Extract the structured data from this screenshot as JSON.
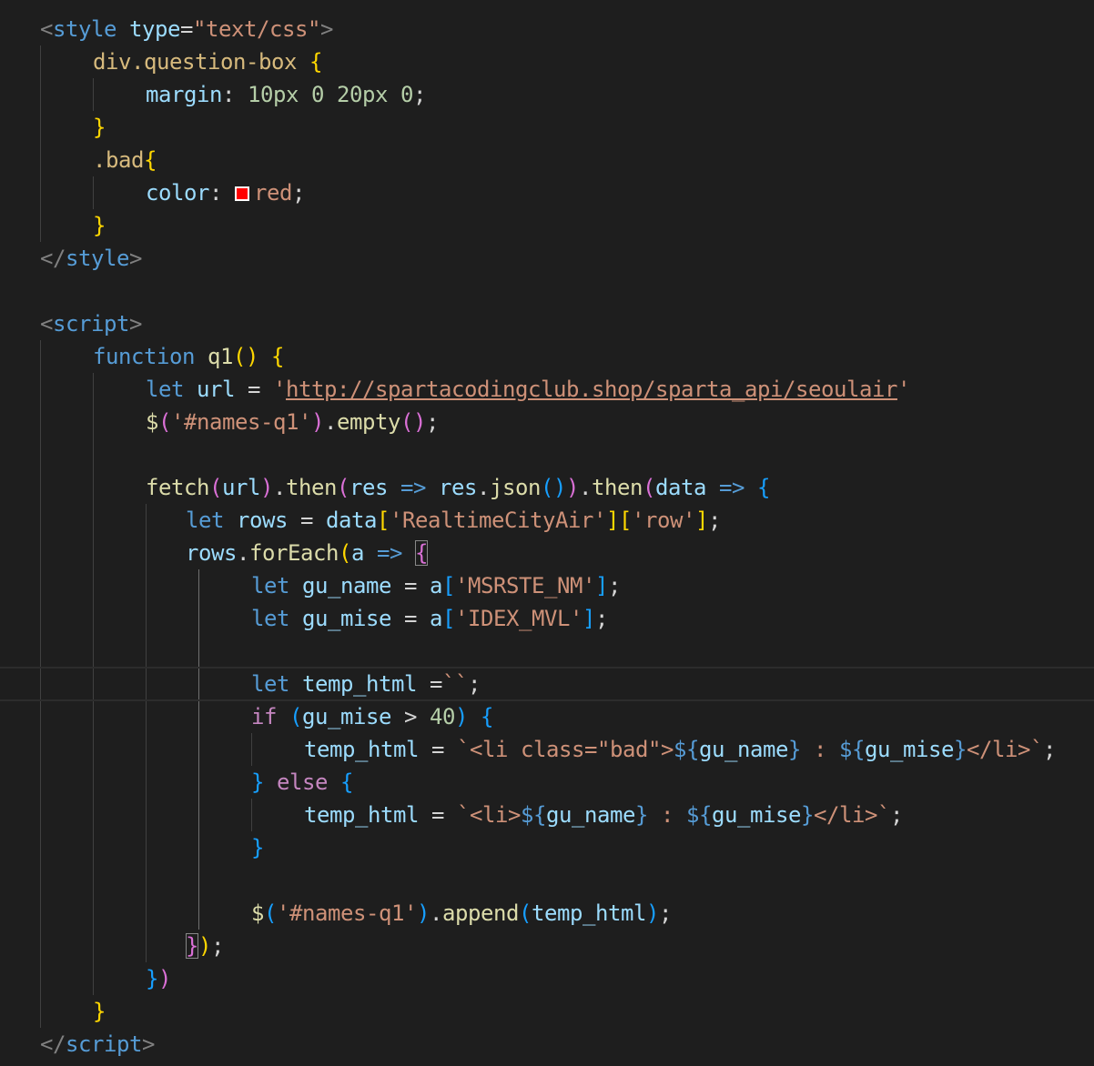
{
  "editor": {
    "theme": "dark",
    "background": "#1e1e1e",
    "current_line_index": 20,
    "lines": [
      {
        "tokens": [
          {
            "t": "<",
            "c": "tag"
          },
          {
            "t": "style",
            "c": "tname"
          },
          {
            "t": " ",
            "c": "pun"
          },
          {
            "t": "type",
            "c": "attr"
          },
          {
            "t": "=",
            "c": "pun"
          },
          {
            "t": "\"text/css\"",
            "c": "str"
          },
          {
            "t": ">",
            "c": "tag"
          }
        ]
      },
      {
        "tokens": [
          {
            "t": "div.question-box",
            "c": "sel"
          },
          {
            "t": " ",
            "c": "pun"
          },
          {
            "t": "{",
            "c": "b1"
          }
        ]
      },
      {
        "tokens": [
          {
            "t": "margin",
            "c": "attr"
          },
          {
            "t": ": ",
            "c": "pun"
          },
          {
            "t": "10px",
            "c": "num"
          },
          {
            "t": " ",
            "c": "pun"
          },
          {
            "t": "0",
            "c": "num"
          },
          {
            "t": " ",
            "c": "pun"
          },
          {
            "t": "20px",
            "c": "num"
          },
          {
            "t": " ",
            "c": "pun"
          },
          {
            "t": "0",
            "c": "num"
          },
          {
            "t": ";",
            "c": "pun"
          }
        ]
      },
      {
        "tokens": [
          {
            "t": "}",
            "c": "b1"
          }
        ]
      },
      {
        "tokens": [
          {
            "t": ".bad",
            "c": "sel"
          },
          {
            "t": "{",
            "c": "b1"
          }
        ]
      },
      {
        "tokens": [
          {
            "t": "color",
            "c": "attr"
          },
          {
            "t": ": ",
            "c": "pun"
          },
          {
            "t": "",
            "c": "swatch",
            "color": "#ff0000"
          },
          {
            "t": "red",
            "c": "str"
          },
          {
            "t": ";",
            "c": "pun"
          }
        ]
      },
      {
        "tokens": [
          {
            "t": "}",
            "c": "b1"
          }
        ]
      },
      {
        "tokens": [
          {
            "t": "</",
            "c": "tag"
          },
          {
            "t": "style",
            "c": "tname"
          },
          {
            "t": ">",
            "c": "tag"
          }
        ]
      },
      {
        "tokens": []
      },
      {
        "tokens": [
          {
            "t": "<",
            "c": "tag"
          },
          {
            "t": "script",
            "c": "tname"
          },
          {
            "t": ">",
            "c": "tag"
          }
        ]
      },
      {
        "tokens": [
          {
            "t": "function",
            "c": "kw"
          },
          {
            "t": " ",
            "c": "pun"
          },
          {
            "t": "q1",
            "c": "fn"
          },
          {
            "t": "()",
            "c": "b1"
          },
          {
            "t": " ",
            "c": "pun"
          },
          {
            "t": "{",
            "c": "b1"
          }
        ]
      },
      {
        "tokens": [
          {
            "t": "let",
            "c": "kw"
          },
          {
            "t": " ",
            "c": "pun"
          },
          {
            "t": "url",
            "c": "var"
          },
          {
            "t": " = ",
            "c": "pun"
          },
          {
            "t": "'",
            "c": "str"
          },
          {
            "t": "http://spartacodingclub.shop/sparta_api/seoulair",
            "c": "url"
          },
          {
            "t": "'",
            "c": "str"
          }
        ]
      },
      {
        "tokens": [
          {
            "t": "$",
            "c": "fn"
          },
          {
            "t": "(",
            "c": "b2"
          },
          {
            "t": "'#names-q1'",
            "c": "str"
          },
          {
            "t": ")",
            "c": "b2"
          },
          {
            "t": ".",
            "c": "pun"
          },
          {
            "t": "empty",
            "c": "fn"
          },
          {
            "t": "()",
            "c": "b2"
          },
          {
            "t": ";",
            "c": "pun"
          }
        ]
      },
      {
        "tokens": []
      },
      {
        "tokens": [
          {
            "t": "fetch",
            "c": "fn"
          },
          {
            "t": "(",
            "c": "b2"
          },
          {
            "t": "url",
            "c": "var"
          },
          {
            "t": ")",
            "c": "b2"
          },
          {
            "t": ".",
            "c": "pun"
          },
          {
            "t": "then",
            "c": "fn"
          },
          {
            "t": "(",
            "c": "b2"
          },
          {
            "t": "res",
            "c": "var"
          },
          {
            "t": " ",
            "c": "pun"
          },
          {
            "t": "=>",
            "c": "kw"
          },
          {
            "t": " ",
            "c": "pun"
          },
          {
            "t": "res",
            "c": "var"
          },
          {
            "t": ".",
            "c": "pun"
          },
          {
            "t": "json",
            "c": "fn"
          },
          {
            "t": "()",
            "c": "b3"
          },
          {
            "t": ")",
            "c": "b2"
          },
          {
            "t": ".",
            "c": "pun"
          },
          {
            "t": "then",
            "c": "fn"
          },
          {
            "t": "(",
            "c": "b2"
          },
          {
            "t": "data",
            "c": "var"
          },
          {
            "t": " ",
            "c": "pun"
          },
          {
            "t": "=>",
            "c": "kw"
          },
          {
            "t": " ",
            "c": "pun"
          },
          {
            "t": "{",
            "c": "b3"
          }
        ]
      },
      {
        "tokens": [
          {
            "t": "let",
            "c": "kw"
          },
          {
            "t": " ",
            "c": "pun"
          },
          {
            "t": "rows",
            "c": "var"
          },
          {
            "t": " = ",
            "c": "pun"
          },
          {
            "t": "data",
            "c": "var"
          },
          {
            "t": "[",
            "c": "b1"
          },
          {
            "t": "'RealtimeCityAir'",
            "c": "str"
          },
          {
            "t": "]",
            "c": "b1"
          },
          {
            "t": "[",
            "c": "b1"
          },
          {
            "t": "'row'",
            "c": "str"
          },
          {
            "t": "]",
            "c": "b1"
          },
          {
            "t": ";",
            "c": "pun"
          }
        ]
      },
      {
        "tokens": [
          {
            "t": "rows",
            "c": "var"
          },
          {
            "t": ".",
            "c": "pun"
          },
          {
            "t": "forEach",
            "c": "fn"
          },
          {
            "t": "(",
            "c": "b1"
          },
          {
            "t": "a",
            "c": "var"
          },
          {
            "t": " ",
            "c": "pun"
          },
          {
            "t": "=>",
            "c": "kw"
          },
          {
            "t": " ",
            "c": "pun"
          },
          {
            "t": "{",
            "c": "b2",
            "bm": true
          }
        ]
      },
      {
        "tokens": [
          {
            "t": "let",
            "c": "kw"
          },
          {
            "t": " ",
            "c": "pun"
          },
          {
            "t": "gu_name",
            "c": "var"
          },
          {
            "t": " = ",
            "c": "pun"
          },
          {
            "t": "a",
            "c": "var"
          },
          {
            "t": "[",
            "c": "b3"
          },
          {
            "t": "'MSRSTE_NM'",
            "c": "str"
          },
          {
            "t": "]",
            "c": "b3"
          },
          {
            "t": ";",
            "c": "pun"
          }
        ]
      },
      {
        "tokens": [
          {
            "t": "let",
            "c": "kw"
          },
          {
            "t": " ",
            "c": "pun"
          },
          {
            "t": "gu_mise",
            "c": "var"
          },
          {
            "t": " = ",
            "c": "pun"
          },
          {
            "t": "a",
            "c": "var"
          },
          {
            "t": "[",
            "c": "b3"
          },
          {
            "t": "'IDEX_MVL'",
            "c": "str"
          },
          {
            "t": "]",
            "c": "b3"
          },
          {
            "t": ";",
            "c": "pun"
          }
        ]
      },
      {
        "tokens": []
      },
      {
        "tokens": [
          {
            "t": "let",
            "c": "kw"
          },
          {
            "t": " ",
            "c": "pun"
          },
          {
            "t": "temp_html",
            "c": "var"
          },
          {
            "t": " =",
            "c": "pun"
          },
          {
            "t": "``",
            "c": "str"
          },
          {
            "t": ";",
            "c": "pun"
          }
        ]
      },
      {
        "tokens": [
          {
            "t": "if",
            "c": "ctl"
          },
          {
            "t": " ",
            "c": "pun"
          },
          {
            "t": "(",
            "c": "b3"
          },
          {
            "t": "gu_mise",
            "c": "var"
          },
          {
            "t": " > ",
            "c": "pun"
          },
          {
            "t": "40",
            "c": "num"
          },
          {
            "t": ")",
            "c": "b3"
          },
          {
            "t": " ",
            "c": "pun"
          },
          {
            "t": "{",
            "c": "b3"
          }
        ]
      },
      {
        "tokens": [
          {
            "t": "temp_html",
            "c": "var"
          },
          {
            "t": " = ",
            "c": "pun"
          },
          {
            "t": "`<li class=\"bad\">",
            "c": "str"
          },
          {
            "t": "${",
            "c": "kw"
          },
          {
            "t": "gu_name",
            "c": "var"
          },
          {
            "t": "}",
            "c": "kw"
          },
          {
            "t": " : ",
            "c": "str"
          },
          {
            "t": "${",
            "c": "kw"
          },
          {
            "t": "gu_mise",
            "c": "var"
          },
          {
            "t": "}",
            "c": "kw"
          },
          {
            "t": "</li>`",
            "c": "str"
          },
          {
            "t": ";",
            "c": "pun"
          }
        ]
      },
      {
        "tokens": [
          {
            "t": "}",
            "c": "b3"
          },
          {
            "t": " ",
            "c": "pun"
          },
          {
            "t": "else",
            "c": "ctl"
          },
          {
            "t": " ",
            "c": "pun"
          },
          {
            "t": "{",
            "c": "b3"
          }
        ]
      },
      {
        "tokens": [
          {
            "t": "temp_html",
            "c": "var"
          },
          {
            "t": " = ",
            "c": "pun"
          },
          {
            "t": "`<li>",
            "c": "str"
          },
          {
            "t": "${",
            "c": "kw"
          },
          {
            "t": "gu_name",
            "c": "var"
          },
          {
            "t": "}",
            "c": "kw"
          },
          {
            "t": " : ",
            "c": "str"
          },
          {
            "t": "${",
            "c": "kw"
          },
          {
            "t": "gu_mise",
            "c": "var"
          },
          {
            "t": "}",
            "c": "kw"
          },
          {
            "t": "</li>`",
            "c": "str"
          },
          {
            "t": ";",
            "c": "pun"
          }
        ]
      },
      {
        "tokens": [
          {
            "t": "}",
            "c": "b3"
          }
        ]
      },
      {
        "tokens": []
      },
      {
        "tokens": [
          {
            "t": "$",
            "c": "fn"
          },
          {
            "t": "(",
            "c": "b3"
          },
          {
            "t": "'#names-q1'",
            "c": "str"
          },
          {
            "t": ")",
            "c": "b3"
          },
          {
            "t": ".",
            "c": "pun"
          },
          {
            "t": "append",
            "c": "fn"
          },
          {
            "t": "(",
            "c": "b3"
          },
          {
            "t": "temp_html",
            "c": "var"
          },
          {
            "t": ")",
            "c": "b3"
          },
          {
            "t": ";",
            "c": "pun"
          }
        ]
      },
      {
        "tokens": [
          {
            "t": "}",
            "c": "b2",
            "bm": true
          },
          {
            "t": ")",
            "c": "b1"
          },
          {
            "t": ";",
            "c": "pun"
          }
        ]
      },
      {
        "tokens": [
          {
            "t": "}",
            "c": "b3"
          },
          {
            "t": ")",
            "c": "b2"
          }
        ]
      },
      {
        "tokens": [
          {
            "t": "}",
            "c": "b1"
          }
        ]
      },
      {
        "tokens": [
          {
            "t": "</",
            "c": "tag"
          },
          {
            "t": "script",
            "c": "tname"
          },
          {
            "t": ">",
            "c": "tag"
          }
        ]
      }
    ]
  }
}
